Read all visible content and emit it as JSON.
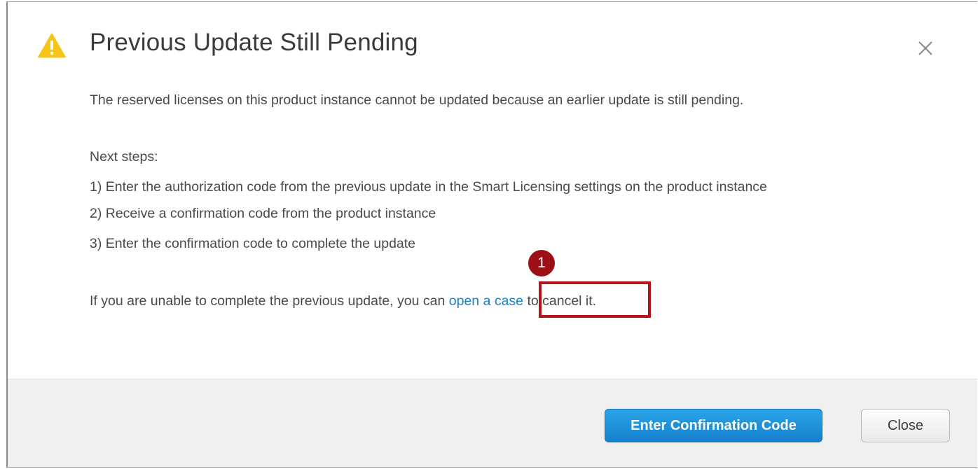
{
  "dialog": {
    "title": "Previous Update Still Pending",
    "icon": "warning-icon",
    "close_icon": "close-icon"
  },
  "body": {
    "intro": "The reserved licenses on this product instance cannot be updated because an earlier update is still pending.",
    "next_steps_heading": "Next steps:",
    "steps": [
      "1) Enter the authorization code from the previous update in the Smart Licensing settings on the product instance",
      "2) Receive a confirmation code from the product instance",
      "3) Enter the confirmation code to complete the update"
    ],
    "case_prefix": "If you are unable to complete the previous update, you can ",
    "case_link": "open a case",
    "case_suffix": " to cancel it."
  },
  "callout": {
    "badge": "1",
    "color": "#b3141b"
  },
  "footer": {
    "primary_label": "Enter Confirmation Code",
    "secondary_label": "Close"
  },
  "colors": {
    "accent": "#1a82c8",
    "warning": "#f5c518"
  }
}
